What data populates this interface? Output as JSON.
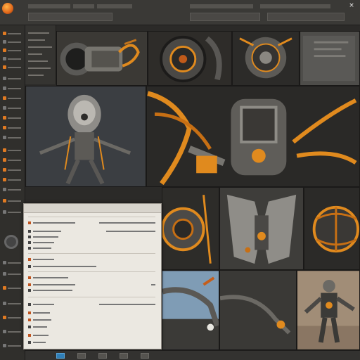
{
  "toolbar": {
    "close_glyph": "×",
    "logo_icon": "app-logo-icon"
  },
  "sidebar": {
    "accent_color": "#e07a22"
  },
  "dialog": {
    "title": ""
  },
  "gallery": {
    "tiles": [
      "mech-engine-render",
      "mech-gear-closeup-1",
      "mech-gear-closeup-2",
      "mech-panel-gray",
      "mech-robot-front",
      "mech-robot-orange-arms",
      "mech-torso-closeup",
      "mech-armor-plate",
      "mech-sphere-cage",
      "mech-claw-sky",
      "mech-dark-tile",
      "mech-soldier-desert"
    ]
  },
  "colors": {
    "accent_orange": "#e08a1e",
    "panel_dark": "#2b2a28",
    "selection_blue": "#2f7fb8"
  }
}
